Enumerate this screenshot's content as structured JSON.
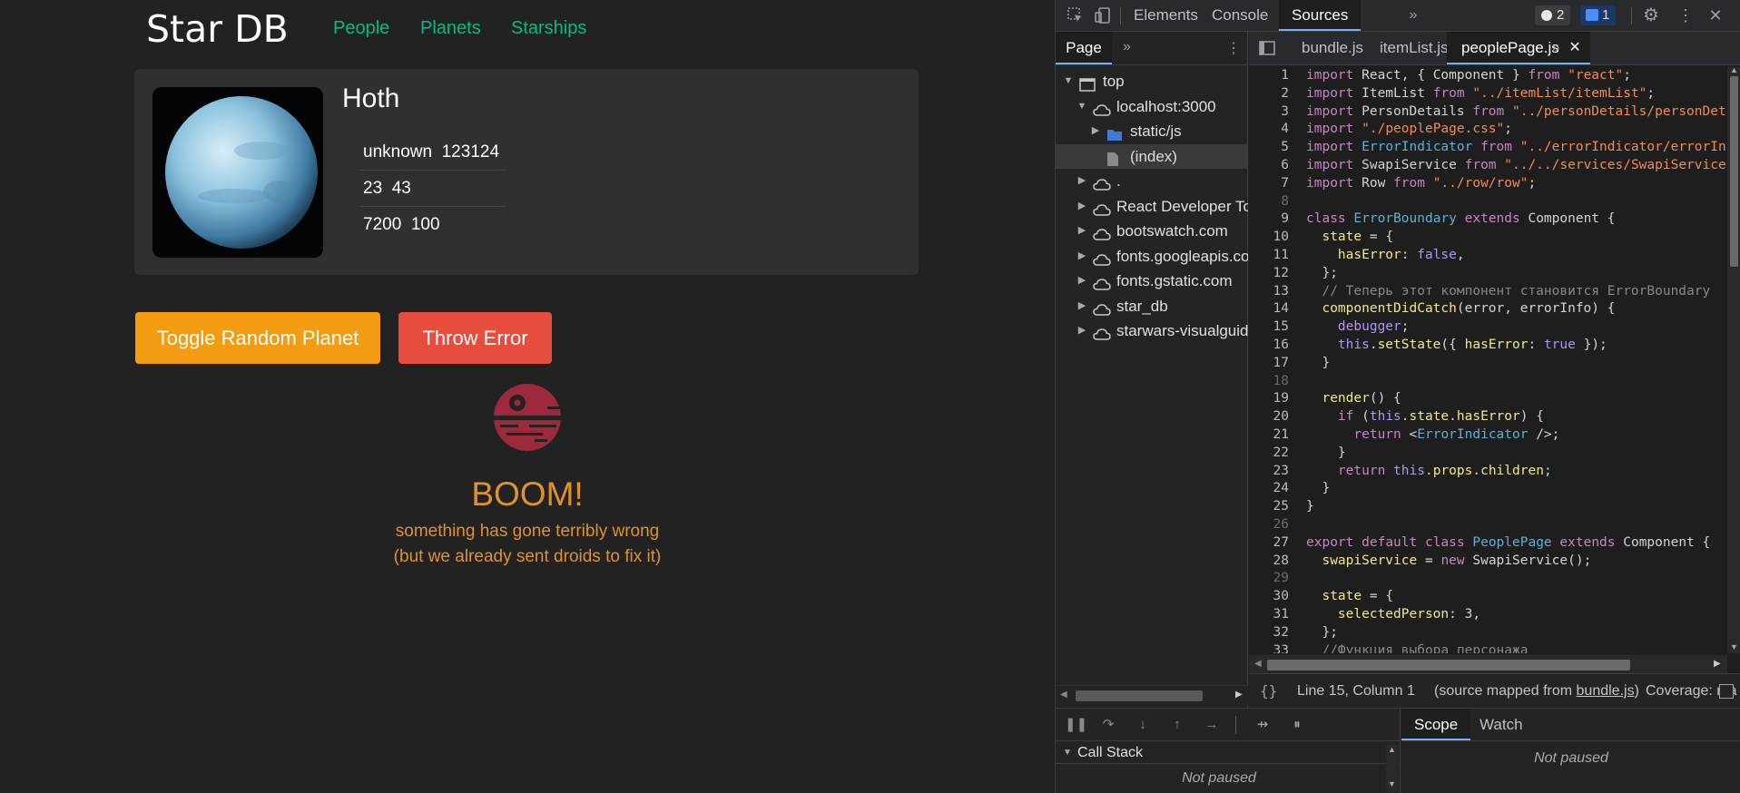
{
  "app": {
    "brand": "Star DB",
    "nav": [
      "People",
      "Planets",
      "Starships"
    ],
    "planet": {
      "name": "Hoth",
      "rows": [
        "unknown  123124",
        "23  43",
        "7200  100"
      ]
    },
    "buttons": {
      "toggle": "Toggle Random Planet",
      "error": "Throw Error"
    },
    "error": {
      "title": "BOOM!",
      "line1": "something has gone terribly wrong",
      "line2": "(but we already sent droids to fix it)"
    }
  },
  "devtools": {
    "tabs": [
      "Elements",
      "Console",
      "Sources"
    ],
    "active_tab": "Sources",
    "issues_count": "2",
    "messages_count": "1",
    "navigator": {
      "tab": "Page",
      "tree": [
        {
          "label": "top",
          "icon": "frame-icon",
          "arrow": "▼",
          "level": 0
        },
        {
          "label": "localhost:3000",
          "icon": "cloud-icon",
          "arrow": "▼",
          "level": 1
        },
        {
          "label": "static/js",
          "icon": "folder-icon",
          "arrow": "▶",
          "level": 2
        },
        {
          "label": "(index)",
          "icon": "file-icon",
          "arrow": "",
          "level": 2,
          "selected": true
        },
        {
          "label": ".",
          "icon": "cloud-icon",
          "arrow": "▶",
          "level": 1
        },
        {
          "label": "React Developer Tools",
          "icon": "cloud-icon",
          "arrow": "▶",
          "level": 1
        },
        {
          "label": "bootswatch.com",
          "icon": "cloud-icon",
          "arrow": "▶",
          "level": 1
        },
        {
          "label": "fonts.googleapis.com",
          "icon": "cloud-icon",
          "arrow": "▶",
          "level": 1
        },
        {
          "label": "fonts.gstatic.com",
          "icon": "cloud-icon",
          "arrow": "▶",
          "level": 1
        },
        {
          "label": "star_db",
          "icon": "cloud-icon",
          "arrow": "▶",
          "level": 1
        },
        {
          "label": "starwars-visualguide.com",
          "icon": "cloud-icon",
          "arrow": "▶",
          "level": 1
        }
      ]
    },
    "editor_tabs": [
      "bundle.js",
      "itemList.js",
      "peoplePage.js"
    ],
    "active_editor_tab": "peoplePage.js",
    "code": [
      "import React, { Component } from \"react\";",
      "import ItemList from \"../itemList/itemList\";",
      "import PersonDetails from \"../personDetails/personDetails\";",
      "import \"./peoplePage.css\";",
      "import ErrorIndicator from \"../errorIndicator/errorIndicator\";",
      "import SwapiService from \"../../services/SwapiService\";",
      "import Row from \"../row/row\";",
      "",
      "class ErrorBoundary extends Component {",
      "  state = {",
      "    hasError: false,",
      "  };",
      "  // Теперь этот компонент становится ErrorBoundary",
      "  componentDidCatch(error, errorInfo) {",
      "    debugger;",
      "    this.setState({ hasError: true });",
      "  }",
      "",
      "  render() {",
      "    if (this.state.hasError) {",
      "      return <ErrorIndicator />;",
      "    }",
      "    return this.props.children;",
      "  }",
      "}",
      "",
      "export default class PeoplePage extends Component {",
      "  swapiService = new SwapiService();",
      "",
      "  state = {",
      "    selectedPerson: 3,",
      "  };",
      "  //Функция выбора персонажа"
    ],
    "status": {
      "position": "Line 15, Column 1",
      "mapped_prefix": "(source mapped from ",
      "mapped_link": "bundle.js",
      "mapped_suffix": ")",
      "coverage": "Coverage: n/a"
    },
    "debugger": {
      "callstack": "Call Stack",
      "not_paused": "Not paused",
      "scope_tabs": [
        "Scope",
        "Watch"
      ],
      "active_scope_tab": "Scope"
    }
  }
}
